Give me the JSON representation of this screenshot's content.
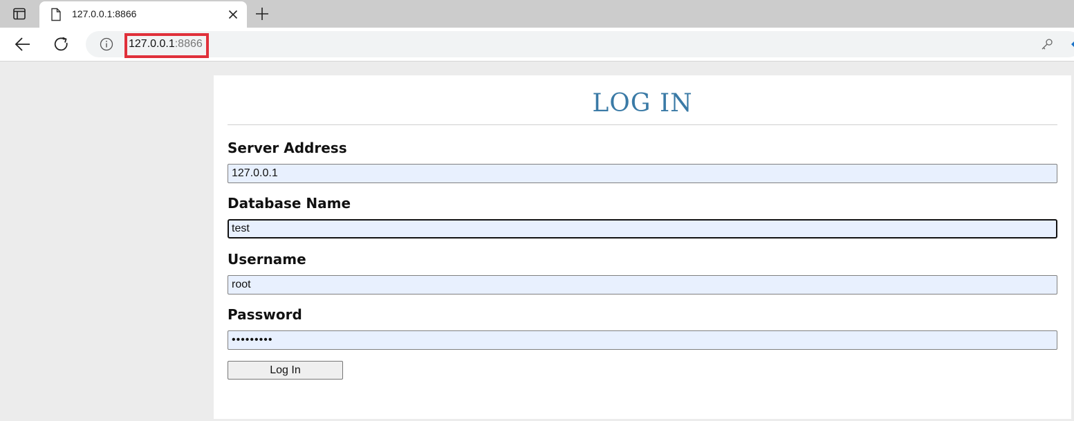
{
  "browser": {
    "tab_title": "127.0.0.1:8866",
    "url_host": "127.0.0.1",
    "url_port": ":8866"
  },
  "page": {
    "title": "LOG IN",
    "fields": [
      {
        "label": "Server Address",
        "value": "127.0.0.1"
      },
      {
        "label": "Database Name",
        "value": "test"
      },
      {
        "label": "Username",
        "value": "root"
      },
      {
        "label": "Password",
        "value": "•••••••••"
      }
    ],
    "submit_label": "Log In"
  },
  "colors": {
    "title": "#3a7aa6",
    "input_autofill_bg": "#e8f0fe",
    "url_highlight": "#e0303a"
  }
}
